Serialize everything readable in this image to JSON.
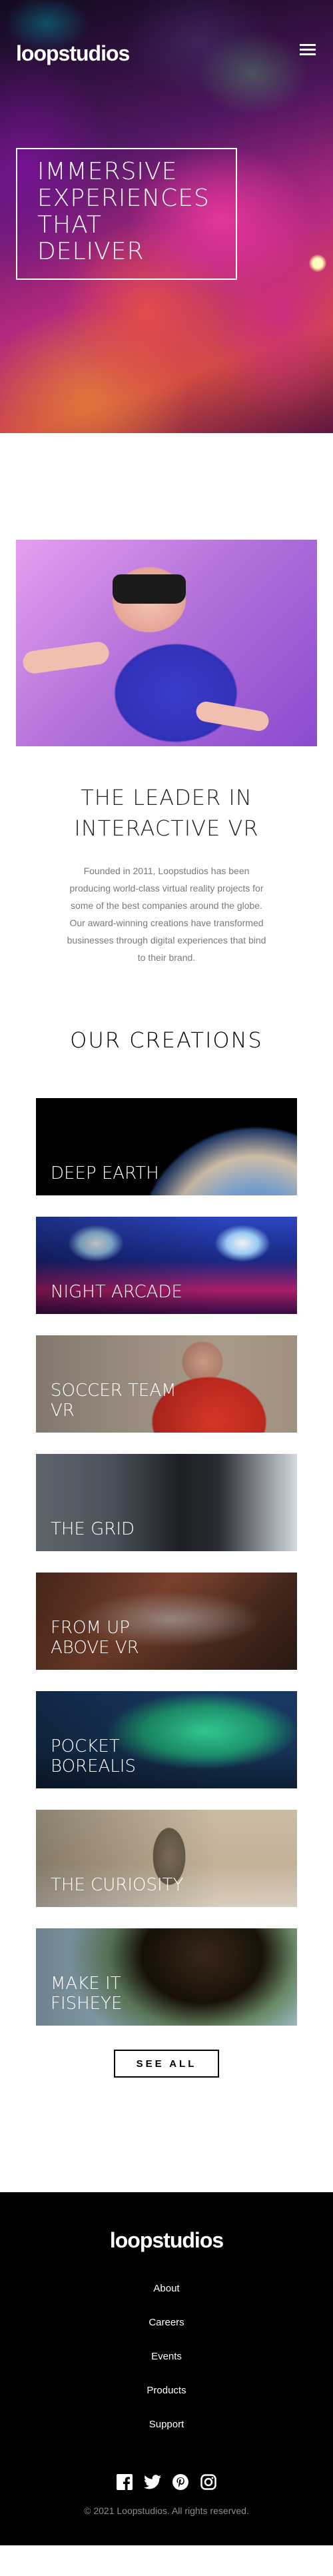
{
  "header": {
    "logo": "loopstudios",
    "menu_icon": "hamburger-menu-icon"
  },
  "hero": {
    "headline_lines": [
      "IMMERSIVE",
      "EXPERIENCES",
      "THAT",
      "DELIVER"
    ]
  },
  "interactive": {
    "title_lines": [
      "THE LEADER IN",
      "INTERACTIVE VR"
    ],
    "body": "Founded in 2011, Loopstudios has been producing world-class virtual reality projects for some of the best companies around the globe. Our award-winning creations have transformed businesses through digital experiences that bind to their brand."
  },
  "creations": {
    "title": "OUR CREATIONS",
    "items": [
      {
        "label": "DEEP EARTH"
      },
      {
        "label": "NIGHT ARCADE"
      },
      {
        "label": "SOCCER TEAM VR"
      },
      {
        "label": "THE GRID"
      },
      {
        "label": "FROM UP ABOVE VR"
      },
      {
        "label": "POCKET BOREALIS"
      },
      {
        "label": "THE CURIOSITY"
      },
      {
        "label": "MAKE IT FISHEYE"
      }
    ],
    "see_all": "SEE ALL"
  },
  "footer": {
    "logo": "loopstudios",
    "nav": [
      "About",
      "Careers",
      "Events",
      "Products",
      "Support"
    ],
    "socials": [
      "facebook-icon",
      "twitter-icon",
      "pinterest-icon",
      "instagram-icon"
    ],
    "copyright": "© 2021 Loopstudios. All rights reserved."
  }
}
